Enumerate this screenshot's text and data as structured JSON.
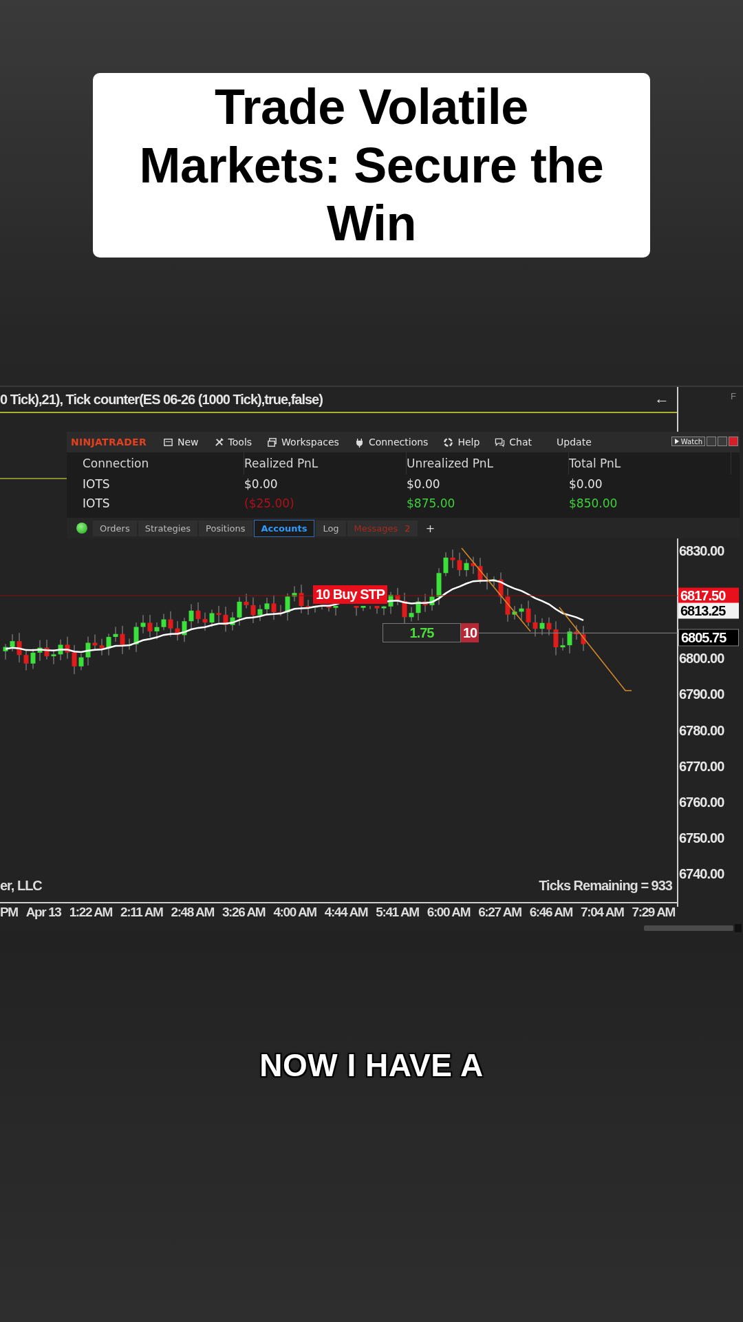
{
  "title_card": {
    "text": "Trade Volatile Markets: Secure the Win"
  },
  "chart_window": {
    "indicator_label": "0 Tick),21), Tick counter(ES 06-26 (1000 Tick),true,false)",
    "back_arrow": "←",
    "side_tab": "F",
    "control_center": {
      "logo": "NINJATRADER",
      "menu": [
        {
          "label": "New",
          "kind": "new"
        },
        {
          "label": "Tools",
          "kind": "tools"
        },
        {
          "label": "Workspaces",
          "kind": "workspaces"
        },
        {
          "label": "Connections",
          "kind": "connections"
        },
        {
          "label": "Help",
          "kind": "help"
        },
        {
          "label": "Chat",
          "kind": "chat"
        },
        {
          "label": "Update",
          "kind": "plain"
        }
      ],
      "watch_button": "Watch",
      "table": {
        "columns": [
          "Connection",
          "Realized PnL",
          "Unrealized PnL",
          "Total PnL"
        ],
        "rows": [
          {
            "cells": [
              {
                "text": "IOTS",
                "color": "#e6e6e6"
              },
              {
                "text": "$0.00",
                "color": "#e6e6e6"
              },
              {
                "text": "$0.00",
                "color": "#e6e6e6"
              },
              {
                "text": "$0.00",
                "color": "#e6e6e6"
              }
            ]
          },
          {
            "cells": [
              {
                "text": "IOTS",
                "color": "#e6e6e6"
              },
              {
                "text": "($25.00)",
                "color": "#b0101a"
              },
              {
                "text": "$875.00",
                "color": "#3ed23a"
              },
              {
                "text": "$850.00",
                "color": "#3ed23a"
              }
            ]
          }
        ]
      },
      "tabs": [
        {
          "label": "Orders",
          "selected": false
        },
        {
          "label": "Strategies",
          "selected": false
        },
        {
          "label": "Positions",
          "selected": false
        },
        {
          "label": "Accounts",
          "selected": true
        },
        {
          "label": "Log",
          "selected": false
        },
        {
          "label": "Messages",
          "selected": false,
          "badge": "2"
        }
      ],
      "add_tab": "+"
    },
    "order_label": "10 Buy STP",
    "position_label": {
      "pnl": "1.75",
      "quantity": "10"
    },
    "price_axis": [
      "6830.00",
      "6800.00",
      "6790.00",
      "6780.00",
      "6770.00",
      "6760.00",
      "6750.00",
      "6740.00"
    ],
    "price_tags": [
      {
        "text": "6817.50",
        "kind": "order"
      },
      {
        "text": "6813.25",
        "kind": "last"
      },
      {
        "text": "6805.75",
        "kind": "position"
      }
    ],
    "copyright": "er, LLC",
    "ticks_remaining": "Ticks Remaining = 933",
    "time_axis": [
      "PM",
      "Apr 13",
      "1:22 AM",
      "2:11 AM",
      "2:48 AM",
      "3:26 AM",
      "4:00 AM",
      "4:44 AM",
      "5:41 AM",
      "6:00 AM",
      "6:27 AM",
      "6:46 AM",
      "7:04 AM",
      "7:29 AM"
    ]
  },
  "caption": "NOW I HAVE A"
}
